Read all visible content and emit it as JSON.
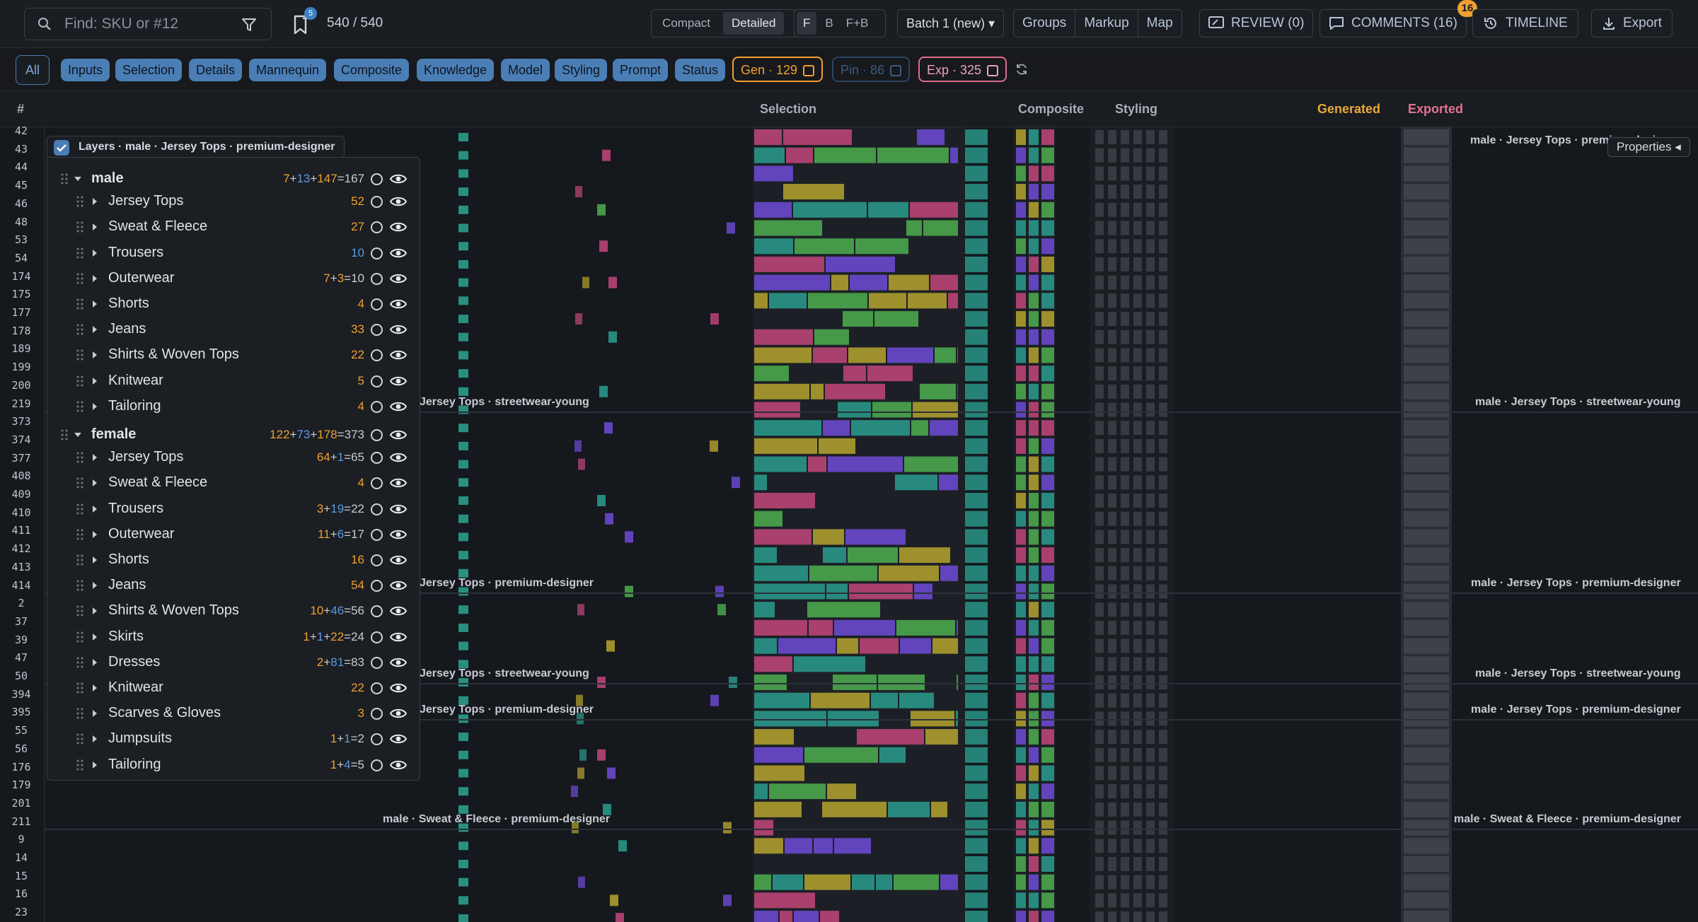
{
  "search": {
    "placeholder": "Find: SKU or #12"
  },
  "bookmarks": {
    "badge": "5",
    "count": "540 / 540"
  },
  "view_toggle": {
    "compact": "Compact",
    "detailed": "Detailed"
  },
  "fb_toggle": {
    "f": "F",
    "b": "B",
    "fb": "F+B"
  },
  "batch": {
    "label": "Batch 1 (new) ▾"
  },
  "modes": {
    "groups": "Groups",
    "markup": "Markup",
    "map": "Map"
  },
  "review": {
    "label": "REVIEW (0)"
  },
  "comments": {
    "label": "COMMENTS (16)",
    "badge": "16"
  },
  "timeline": {
    "label": "TIMELINE"
  },
  "export": {
    "label": "Export"
  },
  "chips": [
    "All",
    "Inputs",
    "Selection",
    "Details",
    "Mannequin",
    "Composite",
    "Knowledge",
    "Model",
    "Styling",
    "Prompt",
    "Status"
  ],
  "stats": {
    "gen": "Gen · 129",
    "pin": "Pin · 86",
    "exp": "Exp · 325"
  },
  "colors": {
    "gen": "#f0a030",
    "pin": "#3b5b80",
    "exp": "#e06a8a",
    "accent": "#4a7eb5",
    "teal": "#2a9d8f",
    "green": "#4caf50",
    "magenta": "#c2477a",
    "purple": "#6f4bd8",
    "olive": "#b5a42f"
  },
  "headers": {
    "num": "#",
    "selection": "Selection",
    "composite": "Composite",
    "styling": "Styling",
    "generated": "Generated",
    "exported": "Exported"
  },
  "row_numbers": [
    "42",
    "43",
    "44",
    "45",
    "46",
    "48",
    "53",
    "54",
    "174",
    "175",
    "177",
    "178",
    "189",
    "199",
    "200",
    "219",
    "373",
    "374",
    "377",
    "408",
    "409",
    "410",
    "411",
    "412",
    "413",
    "414",
    "2",
    "37",
    "39",
    "47",
    "50",
    "394",
    "395",
    "55",
    "56",
    "176",
    "179",
    "201",
    "211",
    "9",
    "14",
    "15",
    "16",
    "23"
  ],
  "group_labels": {
    "g1_left": "Jersey Tops · streetwear-young",
    "g1_right": "male · Jersey Tops · streetwear-young",
    "g2_left": "Jersey Tops · premium-designer",
    "g2_right": "male · Jersey Tops · premium-designer",
    "g3_left": "Jersey Tops · streetwear-young",
    "g3_right": "male · Jersey Tops · streetwear-young",
    "g4_left": "Jersey Tops · premium-designer",
    "g4_right": "male · Jersey Tops · premium-designer",
    "g5_left": "male · Sweat & Fleece · premium-designer",
    "g5_right": "male · Sweat & Fleece · premium-designer",
    "top_right": "male · Jersey Tops · premium-designer"
  },
  "properties": {
    "label": "Properties ◂"
  },
  "layers": {
    "title": "Layers · male · Jersey Tops · premium-designer",
    "items": [
      {
        "label": "male",
        "bold": true,
        "level": 0,
        "count": [
          [
            "7",
            "#f0a030"
          ],
          [
            "+",
            "#c8ccd2"
          ],
          [
            "13",
            "#5b9be0"
          ],
          [
            "+",
            "#c8ccd2"
          ],
          [
            "147",
            "#f0a030"
          ],
          [
            "=167",
            "#c8ccd2"
          ]
        ]
      },
      {
        "label": "Jersey Tops",
        "level": 1,
        "count": [
          [
            "52",
            "#f0a030"
          ]
        ]
      },
      {
        "label": "Sweat & Fleece",
        "level": 1,
        "count": [
          [
            "27",
            "#f0a030"
          ]
        ]
      },
      {
        "label": "Trousers",
        "level": 1,
        "count": [
          [
            "10",
            "#5b9be0"
          ]
        ]
      },
      {
        "label": "Outerwear",
        "level": 1,
        "count": [
          [
            "7",
            "#f0a030"
          ],
          [
            "+",
            "#c8ccd2"
          ],
          [
            "3",
            "#f0a030"
          ],
          [
            "=10",
            "#c8ccd2"
          ]
        ]
      },
      {
        "label": "Shorts",
        "level": 1,
        "count": [
          [
            "4",
            "#f0a030"
          ]
        ]
      },
      {
        "label": "Jeans",
        "level": 1,
        "count": [
          [
            "33",
            "#f0a030"
          ]
        ]
      },
      {
        "label": "Shirts & Woven Tops",
        "level": 1,
        "count": [
          [
            "22",
            "#f0a030"
          ]
        ]
      },
      {
        "label": "Knitwear",
        "level": 1,
        "count": [
          [
            "5",
            "#f0a030"
          ]
        ]
      },
      {
        "label": "Tailoring",
        "level": 1,
        "count": [
          [
            "4",
            "#f0a030"
          ]
        ]
      },
      {
        "label": "female",
        "bold": true,
        "level": 0,
        "count": [
          [
            "122",
            "#f0a030"
          ],
          [
            "+",
            "#c8ccd2"
          ],
          [
            "73",
            "#5b9be0"
          ],
          [
            "+",
            "#c8ccd2"
          ],
          [
            "178",
            "#f0a030"
          ],
          [
            "=373",
            "#c8ccd2"
          ]
        ]
      },
      {
        "label": "Jersey Tops",
        "level": 1,
        "count": [
          [
            "64",
            "#f0a030"
          ],
          [
            "+",
            "#c8ccd2"
          ],
          [
            "1",
            "#5b9be0"
          ],
          [
            "=65",
            "#c8ccd2"
          ]
        ]
      },
      {
        "label": "Sweat & Fleece",
        "level": 1,
        "count": [
          [
            "4",
            "#f0a030"
          ]
        ]
      },
      {
        "label": "Trousers",
        "level": 1,
        "count": [
          [
            "3",
            "#f0a030"
          ],
          [
            "+",
            "#c8ccd2"
          ],
          [
            "19",
            "#5b9be0"
          ],
          [
            "=22",
            "#c8ccd2"
          ]
        ]
      },
      {
        "label": "Outerwear",
        "level": 1,
        "count": [
          [
            "11",
            "#f0a030"
          ],
          [
            "+",
            "#c8ccd2"
          ],
          [
            "6",
            "#5b9be0"
          ],
          [
            "=17",
            "#c8ccd2"
          ]
        ]
      },
      {
        "label": "Shorts",
        "level": 1,
        "count": [
          [
            "16",
            "#f0a030"
          ]
        ]
      },
      {
        "label": "Jeans",
        "level": 1,
        "count": [
          [
            "54",
            "#f0a030"
          ]
        ]
      },
      {
        "label": "Shirts & Woven Tops",
        "level": 1,
        "count": [
          [
            "10",
            "#f0a030"
          ],
          [
            "+",
            "#c8ccd2"
          ],
          [
            "46",
            "#5b9be0"
          ],
          [
            "=56",
            "#c8ccd2"
          ]
        ]
      },
      {
        "label": "Skirts",
        "level": 1,
        "count": [
          [
            "1",
            "#f0a030"
          ],
          [
            "+",
            "#c8ccd2"
          ],
          [
            "1",
            "#5b9be0"
          ],
          [
            "+",
            "#c8ccd2"
          ],
          [
            "22",
            "#f0a030"
          ],
          [
            "=24",
            "#c8ccd2"
          ]
        ]
      },
      {
        "label": "Dresses",
        "level": 1,
        "count": [
          [
            "2",
            "#f0a030"
          ],
          [
            "+",
            "#c8ccd2"
          ],
          [
            "81",
            "#5b9be0"
          ],
          [
            "=83",
            "#c8ccd2"
          ]
        ]
      },
      {
        "label": "Knitwear",
        "level": 1,
        "count": [
          [
            "22",
            "#f0a030"
          ]
        ]
      },
      {
        "label": "Scarves & Gloves",
        "level": 1,
        "count": [
          [
            "3",
            "#f0a030"
          ]
        ]
      },
      {
        "label": "Jumpsuits",
        "level": 1,
        "count": [
          [
            "1",
            "#f0a030"
          ],
          [
            "+",
            "#c8ccd2"
          ],
          [
            "1",
            "#5b9be0"
          ],
          [
            "=2",
            "#c8ccd2"
          ]
        ]
      },
      {
        "label": "Tailoring",
        "level": 1,
        "count": [
          [
            "1",
            "#f0a030"
          ],
          [
            "+",
            "#c8ccd2"
          ],
          [
            "4",
            "#5b9be0"
          ],
          [
            "=5",
            "#c8ccd2"
          ]
        ]
      }
    ]
  }
}
